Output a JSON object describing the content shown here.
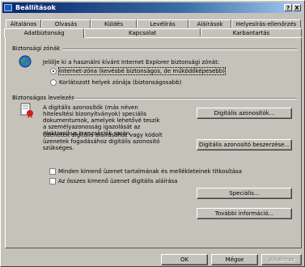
{
  "window": {
    "title": "Beállítások",
    "help_btn": "?",
    "close_btn": "X"
  },
  "tabs_row1": [
    "Általános",
    "Olvasás",
    "Küldés",
    "Levélírás",
    "Aláírások",
    "Helyesírás-ellenőrzés"
  ],
  "tabs_row2": [
    "Adatbiztonság",
    "Kapcsolat",
    "Karbantartás"
  ],
  "zones": {
    "heading": "Biztonsági zónák",
    "desc": "Jelölje ki a használni kívánt Internet Explorer biztonsági zónát:",
    "option1": "Internet-zóna (kevésbé biztonságos, de működőképesebb)",
    "option2": "Korlátozott helyek zónája (biztonságosabb)",
    "selected": "option1"
  },
  "secure_mail": {
    "heading": "Biztonságos levelezés",
    "desc1": "A digitális azonosítók (más néven hitelesítési bizonyítványok) speciális dokumentumok, amelyek lehetővé teszik a személyazonosság igazolását az elektronikus tranzakciók során.",
    "desc2": "Üzenetek digitális aláírásához vagy kódolt üzenetek fogadásához digitális azonosító szükséges.",
    "btn_ids": "Digitális azonosítók...",
    "btn_get": "Digitális azonosító beszerzése...",
    "check1": "Minden kimenő üzenet tartalmának és mellékleteinek titkosítása",
    "check2": "Az összes kimenő üzenet digitális aláírása",
    "btn_special": "Speciális...",
    "btn_more": "További információ..."
  },
  "footer": {
    "ok": "OK",
    "cancel": "Mégse",
    "apply": "Alkalmaz"
  },
  "colors": {
    "title_start": "#08246b",
    "title_end": "#a6caf0",
    "face": "#c5c2b9"
  }
}
